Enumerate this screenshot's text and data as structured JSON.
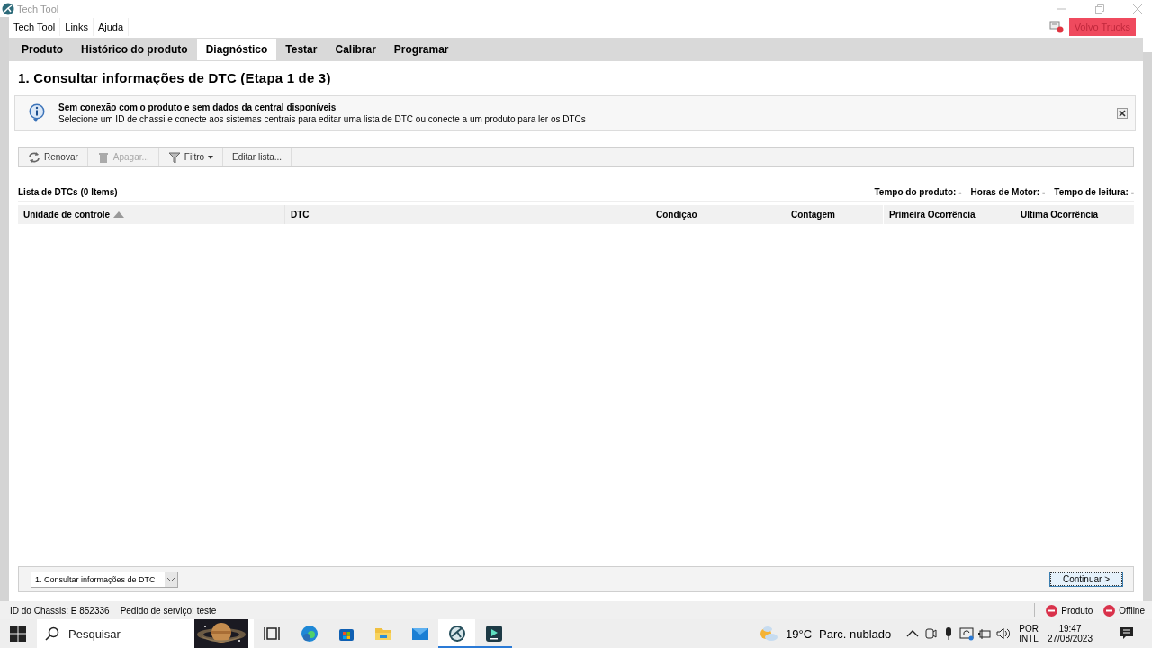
{
  "window": {
    "title": "Tech Tool"
  },
  "menu": [
    "Tech Tool",
    "Links",
    "Ajuda"
  ],
  "brand": "Volvo Trucks",
  "tabs": [
    {
      "label": "Produto",
      "selected": false
    },
    {
      "label": "Histórico do produto",
      "selected": false
    },
    {
      "label": "Diagnóstico",
      "selected": true
    },
    {
      "label": "Testar",
      "selected": false
    },
    {
      "label": "Calibrar",
      "selected": false
    },
    {
      "label": "Programar",
      "selected": false
    }
  ],
  "heading": "1. Consultar informações de DTC (Etapa 1 de 3)",
  "notice": {
    "title": "Sem conexão com o produto e sem dados da central disponíveis",
    "message": "Selecione um ID de chassi e conecte aos sistemas centrais para editar uma lista de DTC ou conecte a um produto para ler os DTCs"
  },
  "toolbar": [
    {
      "label": "Renovar",
      "kind": "refresh",
      "disabled": false,
      "dropdown": false
    },
    {
      "label": "Apagar...",
      "kind": "trash",
      "disabled": true,
      "dropdown": false
    },
    {
      "label": "Filtro",
      "kind": "filter",
      "disabled": false,
      "dropdown": true
    },
    {
      "label": "Editar lista...",
      "kind": "plain",
      "disabled": false,
      "dropdown": false
    }
  ],
  "list": {
    "title": "Lista de DTCs (0 Items)",
    "stats": [
      "Tempo do produto: -",
      "Horas de Motor: -",
      "Tempo de leitura: -"
    ]
  },
  "table": {
    "columns": [
      {
        "label": "Unidade de controle",
        "sorted": true
      },
      {
        "label": "DTC",
        "sorted": false
      },
      {
        "label": "Condição",
        "sorted": false
      },
      {
        "label": "Contagem",
        "sorted": false
      },
      {
        "label": "Primeira Ocorrência",
        "sorted": false
      },
      {
        "label": "Ultima Ocorrência",
        "sorted": false
      }
    ]
  },
  "step_select": {
    "value": "1. Consultar informações de DTC"
  },
  "continue_button": "Continuar >",
  "status_bar": {
    "fields": [
      "ID do Chassis: E 852336",
      "Pedido de serviço: teste"
    ],
    "indicators": [
      "Produto",
      "Offline"
    ]
  },
  "taskbar": {
    "search": {
      "placeholder": "Pesquisar"
    },
    "apps": [
      {
        "kind": "taskview",
        "selected": false,
        "running": false
      },
      {
        "kind": "edge",
        "selected": false,
        "running": false
      },
      {
        "kind": "store",
        "selected": false,
        "running": false
      },
      {
        "kind": "folder",
        "selected": false,
        "running": false
      },
      {
        "kind": "mail",
        "selected": false,
        "running": false
      },
      {
        "kind": "techtool",
        "selected": true,
        "running": true
      },
      {
        "kind": "editor",
        "selected": false,
        "running": true
      }
    ],
    "weather": {
      "temperature": "19°C",
      "condition": "Parc. nublado"
    },
    "language": [
      "POR",
      "INTL"
    ],
    "time": "19:47",
    "date": "27/08/2023"
  }
}
